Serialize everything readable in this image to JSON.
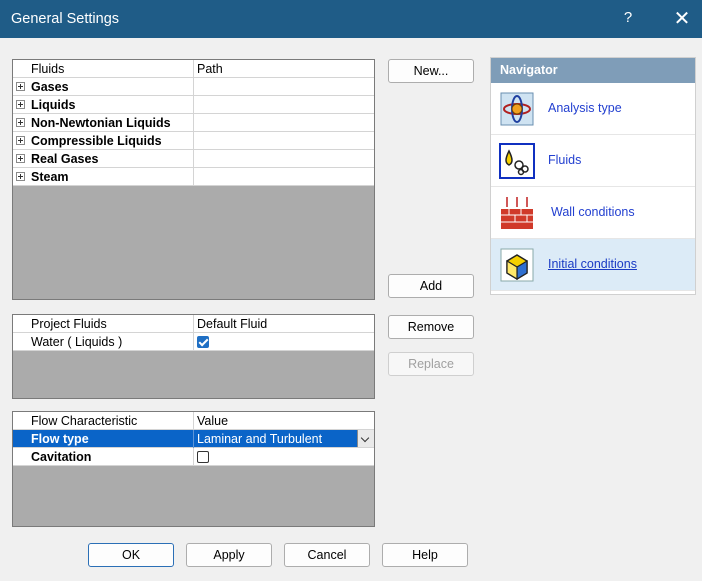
{
  "window": {
    "title": "General Settings",
    "help_glyph": "?",
    "close_glyph": "✕"
  },
  "fluids_table": {
    "headers": [
      "Fluids",
      "Path"
    ],
    "rows": [
      {
        "label": "Gases"
      },
      {
        "label": "Liquids"
      },
      {
        "label": "Non-Newtonian Liquids"
      },
      {
        "label": "Compressible Liquids"
      },
      {
        "label": "Real Gases"
      },
      {
        "label": "Steam"
      }
    ]
  },
  "project_fluids": {
    "headers": [
      "Project Fluids",
      "Default Fluid"
    ],
    "rows": [
      {
        "label": "Water ( Liquids )",
        "default": true
      }
    ]
  },
  "flow_table": {
    "headers": [
      "Flow Characteristic",
      "Value"
    ],
    "rows": [
      {
        "label": "Flow type",
        "value": "Laminar and Turbulent"
      },
      {
        "label": "Cavitation",
        "value": false
      }
    ]
  },
  "buttons": {
    "new": "New...",
    "add": "Add",
    "remove": "Remove",
    "replace": "Replace",
    "ok": "OK",
    "apply": "Apply",
    "cancel": "Cancel",
    "help": "Help"
  },
  "navigator": {
    "title": "Navigator",
    "items": [
      {
        "label": "Analysis type",
        "icon": "analysis-type-icon"
      },
      {
        "label": "Fluids",
        "icon": "fluids-icon"
      },
      {
        "label": "Wall conditions",
        "icon": "wall-conditions-icon"
      },
      {
        "label": "Initial conditions",
        "icon": "initial-conditions-icon",
        "selected": true
      }
    ]
  },
  "colors": {
    "titlebar": "#1f5c87",
    "selection": "#0a64c8",
    "navigator_header": "#7f9db8",
    "link": "#2340d0"
  }
}
